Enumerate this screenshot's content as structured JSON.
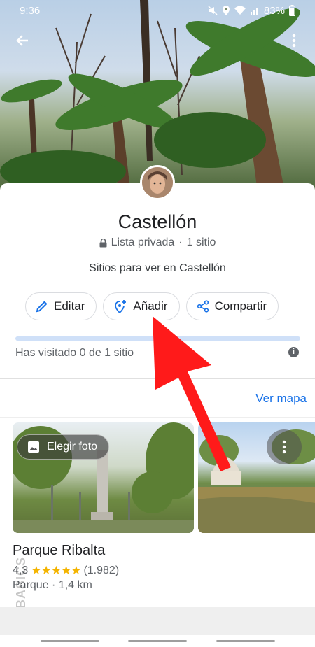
{
  "status_bar": {
    "time": "9:36",
    "battery": "83%"
  },
  "list": {
    "title": "Castellón",
    "privacy": "Lista privada",
    "count": "1 sitio",
    "separator": "·",
    "description": "Sitios para ver en Castellón"
  },
  "actions": {
    "edit": "Editar",
    "add": "Añadir",
    "share": "Compartir"
  },
  "progress": {
    "visited_text": "Has visitado 0 de 1 sitio",
    "fraction": 0.0,
    "info": "i"
  },
  "map_link": "Ver mapa",
  "photo": {
    "choose_label": "Elegir foto"
  },
  "place": {
    "name": "Parque Ribalta",
    "rating": "4,3",
    "stars": "★★★★★",
    "reviews": "(1.982)",
    "category": "Parque",
    "distance": "1,4 km",
    "meta_separator": "·"
  },
  "watermark": "K BASICS",
  "colors": {
    "accent": "#1a73e8",
    "arrow": "#ff1a1a",
    "progress_track": "#cfe0f8",
    "star": "#f4b400"
  }
}
